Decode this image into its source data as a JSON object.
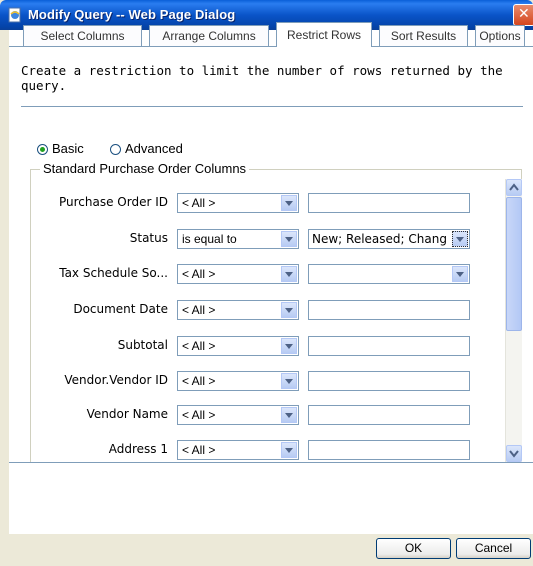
{
  "window": {
    "title": "Modify Query -- Web Page Dialog"
  },
  "tabs": [
    {
      "label": "Select Columns"
    },
    {
      "label": "Arrange Columns"
    },
    {
      "label": "Restrict Rows"
    },
    {
      "label": "Sort Results"
    },
    {
      "label": "Options"
    }
  ],
  "active_tab": "Restrict Rows",
  "description": "Create a restriction to limit the number of rows returned by the query.",
  "mode": {
    "basic_label": "Basic",
    "advanced_label": "Advanced",
    "selected": "Basic"
  },
  "group_title": "Standard Purchase Order Columns",
  "rows": [
    {
      "label": "Purchase Order ID",
      "operator": "< All >",
      "value": ""
    },
    {
      "label": "Status",
      "operator": "is equal to",
      "value": "New; Released; Chang"
    },
    {
      "label": "Tax Schedule So...",
      "operator": "< All >",
      "value": ""
    },
    {
      "label": "Document Date",
      "operator": "< All >",
      "value": ""
    },
    {
      "label": "Subtotal",
      "operator": "< All >",
      "value": ""
    },
    {
      "label": "Vendor.Vendor ID",
      "operator": "< All >",
      "value": ""
    },
    {
      "label": "Vendor Name",
      "operator": "< All >",
      "value": ""
    },
    {
      "label": "Address 1",
      "operator": "< All >",
      "value": ""
    }
  ],
  "buttons": {
    "ok": "OK",
    "cancel": "Cancel"
  },
  "colors": {
    "titlebar": "#0a54c8",
    "border": "#7f9db9",
    "dialog_bg": "#ece9d8"
  }
}
